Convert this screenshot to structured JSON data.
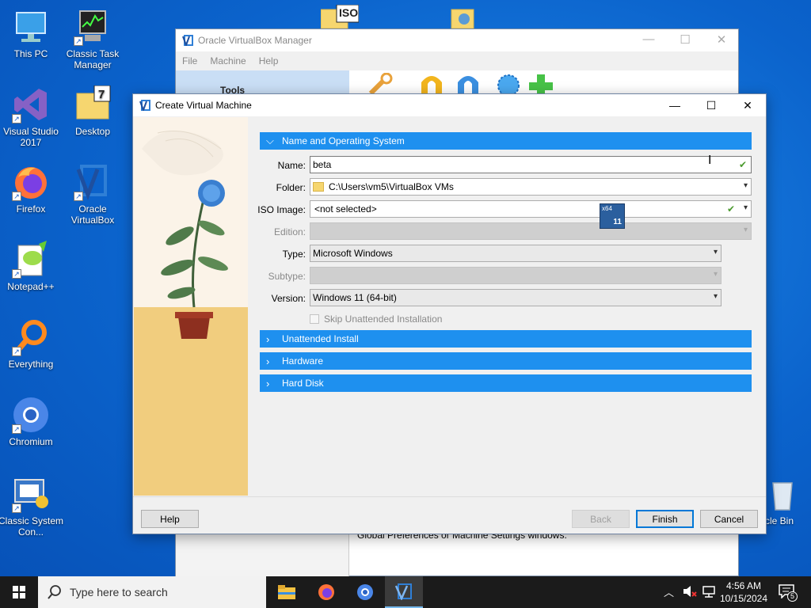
{
  "desktop": {
    "icons": [
      {
        "label": "This PC"
      },
      {
        "label": "Classic Task Manager"
      },
      {
        "label": "Visual Studio 2017"
      },
      {
        "label": "Desktop"
      },
      {
        "label": "Firefox"
      },
      {
        "label": "Oracle VirtualBox"
      },
      {
        "label": "Notepad++"
      },
      {
        "label": "Everything"
      },
      {
        "label": "Chromium"
      },
      {
        "label": "Classic System Con..."
      },
      {
        "label": "rcle Bin"
      }
    ],
    "top_file_label": "ISO"
  },
  "manager": {
    "title": "Oracle VirtualBox Manager",
    "menu": [
      "File",
      "Machine",
      "Help"
    ],
    "tools_label": "Tools",
    "hint_text": "Global Preferences or Machine Settings windows."
  },
  "dialog": {
    "title": "Create Virtual Machine",
    "sections": {
      "name_os": "Name and Operating System",
      "unattended": "Unattended Install",
      "hardware": "Hardware",
      "hard_disk": "Hard Disk"
    },
    "labels": {
      "name": "Name:",
      "folder": "Folder:",
      "iso": "ISO Image:",
      "edition": "Edition:",
      "type": "Type:",
      "subtype": "Subtype:",
      "version": "Version:"
    },
    "values": {
      "name": "beta",
      "folder": "C:\\Users\\vm5\\VirtualBox VMs",
      "iso": "<not selected>",
      "type": "Microsoft Windows",
      "version": "Windows 11 (64-bit)"
    },
    "os_badge": {
      "top": "x64",
      "bottom": "11"
    },
    "skip_unattended": "Skip Unattended Installation",
    "buttons": {
      "help": "Help",
      "back": "Back",
      "finish": "Finish",
      "cancel": "Cancel"
    }
  },
  "taskbar": {
    "search_placeholder": "Type here to search",
    "time": "4:56 AM",
    "date": "10/15/2024",
    "notification_count": "5"
  },
  "colors": {
    "accent": "#1e90ef",
    "desktop": "#0b63cc",
    "taskbar": "#1b1b1b"
  }
}
